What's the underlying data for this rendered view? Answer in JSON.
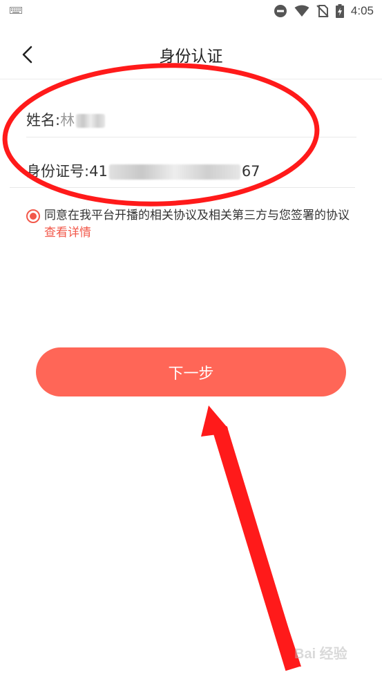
{
  "status_bar": {
    "time": "4:05"
  },
  "nav": {
    "title": "身份认证"
  },
  "form": {
    "name_label": "姓名:",
    "name_value_visible": "林",
    "id_label": "身份证号:",
    "id_prefix": "41",
    "id_suffix": "67"
  },
  "agreement": {
    "text": "同意在我平台开播的相关协议及相关第三方与您签署的协议",
    "link": "查看详情"
  },
  "next_button": {
    "label": "下一步"
  },
  "watermark": {
    "text": "Bai 经验"
  },
  "colors": {
    "accent": "#ff6657",
    "link": "#f2584a",
    "annotation": "#ff1a1a"
  }
}
